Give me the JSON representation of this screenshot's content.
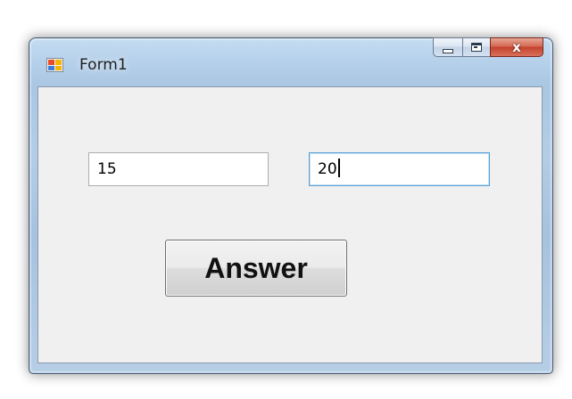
{
  "window": {
    "title": "Form1",
    "close_symbol": "x",
    "icons": {
      "app": "form-app-icon",
      "minimize": "minimize-icon",
      "maximize": "maximize-icon",
      "close": "close-icon"
    }
  },
  "form": {
    "textbox1_value": "15",
    "textbox2_value": "20",
    "answer_button_label": "Answer"
  },
  "colors": {
    "client_background": "#f0f0f0",
    "close_button": "#c4412c",
    "focus_border": "#5c9fd6"
  }
}
